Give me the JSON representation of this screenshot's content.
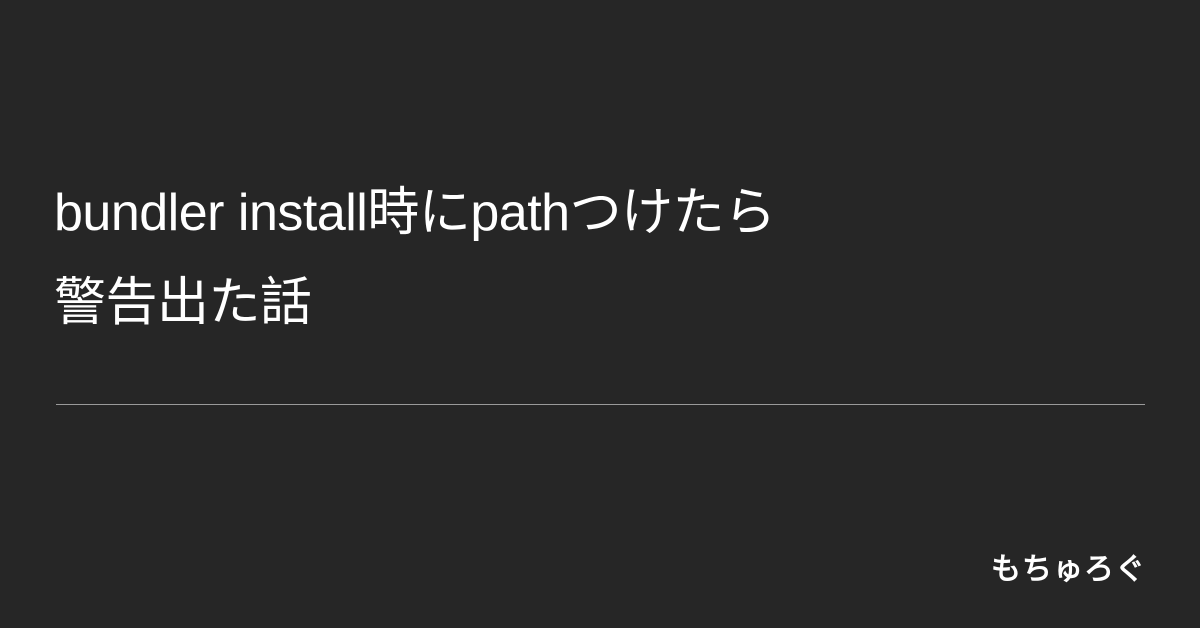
{
  "title": {
    "line1": "bundler install時にpathつけたら",
    "line2": "警告出た話"
  },
  "site": {
    "name": "もちゅろぐ"
  }
}
